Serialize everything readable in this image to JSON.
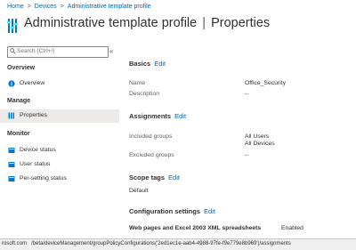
{
  "breadcrumb": {
    "items": [
      "Home",
      "Devices",
      "Administrative template profile"
    ]
  },
  "header": {
    "title": "Administrative template profile",
    "divider": "|",
    "subtitle": "Properties",
    "more": "···"
  },
  "sidebar": {
    "search_placeholder": "Search (Ctrl+/)",
    "collapse": "«",
    "sections": {
      "overview": "Overview",
      "manage": "Manage",
      "monitor": "Monitor"
    },
    "items": {
      "overview": "Overview",
      "properties": "Properties",
      "device_status": "Device status",
      "user_status": "User status",
      "per_setting_status": "Per-setting status"
    }
  },
  "main": {
    "edit_label": "Edit",
    "basics": {
      "title": "Basics",
      "name_label": "Name",
      "name_value": "Office_Security",
      "description_label": "Description",
      "description_value": "--"
    },
    "assignments": {
      "title": "Assignments",
      "included_label": "Included groups",
      "included_values": [
        "All Users",
        "All Devices"
      ],
      "excluded_label": "Excluded groups",
      "excluded_value": "--"
    },
    "scope_tags": {
      "title": "Scope tags",
      "value": "Default"
    },
    "configuration": {
      "title": "Configuration settings",
      "setting_label": "Web pages and Excel 2003 XML spreadsheets",
      "setting_value": "Enabled"
    }
  },
  "statusbar": {
    "domain": "rosoft.com",
    "path": "/beta/deviceManagement/groupPolicyConfigurations('2ed1ec1e-aab4-4988-97fe-f9e779e8b969')/assignments"
  },
  "colors": {
    "accent": "#0067b8",
    "selected_bg": "#edebe9",
    "statusbar_bg": "#f0f0f0"
  }
}
